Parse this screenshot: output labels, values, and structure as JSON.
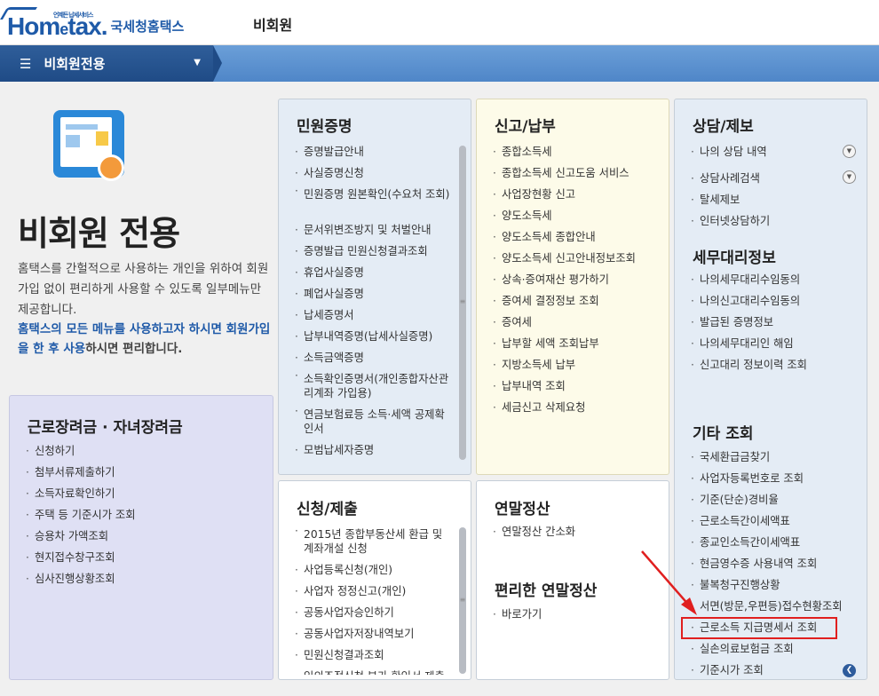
{
  "header": {
    "logo_text": "Hom",
    "logo_e": "e",
    "logo_text2": "tax.",
    "logo_tagline": "언제든 납세서비스",
    "logo_kr": "국세청홈택스",
    "title": "비회원"
  },
  "nav": {
    "menu_label": "비회원전용"
  },
  "hero": {
    "title": "비회원 전용",
    "desc": "홈택스를 간헐적으로 사용하는 개인을 위하여 회원가입 없이 편리하게 사용할 수 있도록 일부메뉴만 제공합니다.",
    "desc2_hl": "홈택스의 모든 메뉴를 사용하고자 하시면 회원가입을 한 후 사용",
    "desc2_tail": "하시면 편리합니다."
  },
  "panels": {
    "civil": {
      "title": "민원증명",
      "items": [
        "증명발급안내",
        "사실증명신청",
        "민원증명 원본확인(수요처 조회)",
        "문서위변조방지 및 처벌안내",
        "증명발급 민원신청결과조회",
        "휴업사실증명",
        "폐업사실증명",
        "납세증명서",
        "납부내역증명(납세사실증명)",
        "소득금액증명",
        "소득확인증명서(개인종합자산관리계좌 가입용)",
        "연금보험료등 소득·세액 공제확인서",
        "모범납세자증명"
      ]
    },
    "report": {
      "title": "신고/납부",
      "items": [
        "종합소득세",
        "종합소득세 신고도움 서비스",
        "사업장현황 신고",
        "양도소득세",
        "양도소득세 종합안내",
        "양도소득세 신고안내정보조회",
        "상속·증여재산 평가하기",
        "증여세 결정정보 조회",
        "증여세",
        "납부할 세액 조회납부",
        "지방소득세 납부",
        "납부내역 조회",
        "세금신고 삭제요청"
      ]
    },
    "consult": {
      "title": "상담/제보",
      "items": [
        "나의 상담 내역",
        "상담사례검색",
        "탈세제보",
        "인터넷상담하기"
      ],
      "agent_title": "세무대리정보",
      "agent_items": [
        "나의세무대리수임동의",
        "나의신고대리수임동의",
        "발급된 증명정보",
        "나의세무대리인 해임",
        "신고대리 정보이력 조회"
      ],
      "etc_title": "기타 조회",
      "etc_items": [
        "국세환급금찾기",
        "사업자등록번호로 조회",
        "기준(단순)경비율",
        "근로소득간이세액표",
        "종교인소득간이세액표",
        "현금영수증 사용내역 조회",
        "불복청구진행상황",
        "서면(방문,우편등)접수현황조회",
        "근로소득 지급명세서 조회",
        "실손의료보험금 조회",
        "기준시가 조회"
      ]
    },
    "apply": {
      "title": "신청/제출",
      "items": [
        "2015년 종합부동산세 환급 및 계좌개설 신청",
        "사업등록신청(개인)",
        "사업자 정정신고(개인)",
        "공동사업자승인하기",
        "공동사업자저장내역보기",
        "민원신청결과조회",
        "임의조정신청 부가 환인서 제출"
      ]
    },
    "year": {
      "title": "연말정산",
      "items": [
        "연말정산 간소화"
      ],
      "convenient_title": "편리한 연말정산",
      "convenient_items": [
        "바로가기"
      ]
    },
    "work": {
      "title": "근로장려금 · 자녀장려금",
      "items": [
        "신청하기",
        "첨부서류제출하기",
        "소득자료확인하기",
        "주택 등 기준시가 조회",
        "승용차 가액조회",
        "현지접수창구조회",
        "심사진행상황조회"
      ]
    }
  },
  "colors": {
    "nav_dark": "#1f4b86",
    "nav_light": "#5a8fcf",
    "highlight_box": "#e01f1f",
    "brand": "#1e5aa8"
  }
}
